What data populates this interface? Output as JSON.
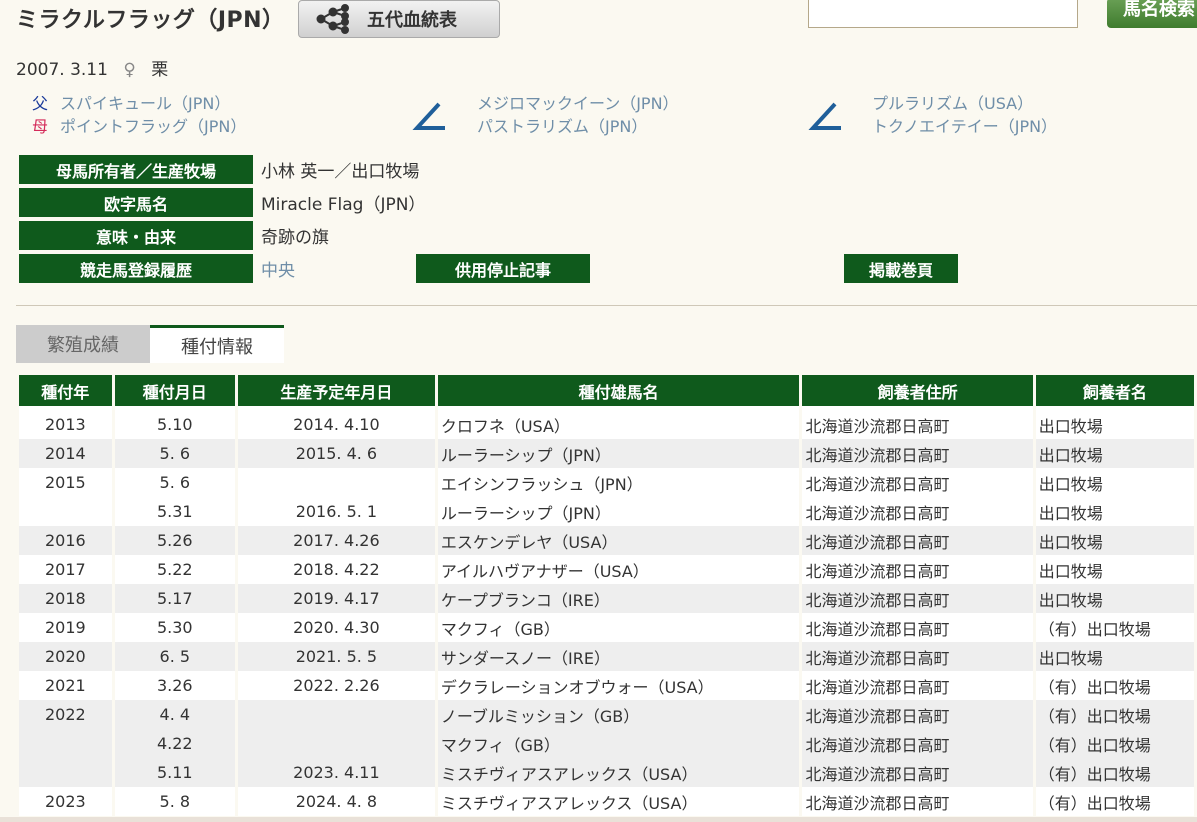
{
  "horse": {
    "name": "ミラクルフラッグ（JPN）",
    "pedigree_button": "五代血統表",
    "birth_date": "2007. 3.11",
    "sex_symbol": "♀",
    "color": "栗"
  },
  "search": {
    "button_label": "馬名検索"
  },
  "parents": {
    "sire_tag": "父",
    "dam_tag": "母",
    "sire": "スパイキュール（JPN）",
    "dam": "ポイントフラッグ（JPN）",
    "sire_sire": "メジロマックイーン（JPN）",
    "sire_dam": "パストラリズム（JPN）",
    "dam_sire": "プルラリズム（USA）",
    "dam_dam": "トクノエイテイー（JPN）"
  },
  "info": {
    "owner_label": "母馬所有者／生産牧場",
    "owner_value": "小林 英一／出口牧場",
    "roman_label": "欧字馬名",
    "roman_value": "Miracle Flag（JPN）",
    "meaning_label": "意味・由来",
    "meaning_value": "奇跡の旗",
    "race_label": "競走馬登録履歴",
    "race_value": "中央",
    "retire_button": "供用停止記事",
    "page_button": "掲載巻頁"
  },
  "tabs": {
    "breeding_results": "繁殖成績",
    "mating_info": "種付情報"
  },
  "table": {
    "headers": [
      "種付年",
      "種付月日",
      "生産予定年月日",
      "種付雄馬名",
      "飼養者住所",
      "飼養者名"
    ],
    "rows": [
      {
        "year": "2013",
        "date": "5.10",
        "due": "2014. 4.10",
        "sire": "クロフネ（USA）",
        "address": "北海道沙流郡日高町",
        "keeper": "出口牧場"
      },
      {
        "year": "2014",
        "date": "5. 6",
        "due": "2015. 4. 6",
        "sire": "ルーラーシップ（JPN）",
        "address": "北海道沙流郡日高町",
        "keeper": "出口牧場"
      },
      {
        "year": "2015",
        "date": "5. 6",
        "due": "",
        "sire": "エイシンフラッシュ（JPN）",
        "address": "北海道沙流郡日高町",
        "keeper": "出口牧場"
      },
      {
        "year": "",
        "date": "5.31",
        "due": "2016. 5. 1",
        "sire": "ルーラーシップ（JPN）",
        "address": "北海道沙流郡日高町",
        "keeper": "出口牧場"
      },
      {
        "year": "2016",
        "date": "5.26",
        "due": "2017. 4.26",
        "sire": "エスケンデレヤ（USA）",
        "address": "北海道沙流郡日高町",
        "keeper": "出口牧場"
      },
      {
        "year": "2017",
        "date": "5.22",
        "due": "2018. 4.22",
        "sire": "アイルハヴアナザー（USA）",
        "address": "北海道沙流郡日高町",
        "keeper": "出口牧場"
      },
      {
        "year": "2018",
        "date": "5.17",
        "due": "2019. 4.17",
        "sire": "ケープブランコ（IRE）",
        "address": "北海道沙流郡日高町",
        "keeper": "出口牧場"
      },
      {
        "year": "2019",
        "date": "5.30",
        "due": "2020. 4.30",
        "sire": "マクフィ（GB）",
        "address": "北海道沙流郡日高町",
        "keeper": "（有）出口牧場"
      },
      {
        "year": "2020",
        "date": "6. 5",
        "due": "2021. 5. 5",
        "sire": "サンダースノー（IRE）",
        "address": "北海道沙流郡日高町",
        "keeper": "出口牧場"
      },
      {
        "year": "2021",
        "date": "3.26",
        "due": "2022. 2.26",
        "sire": "デクラレーションオブウォー（USA）",
        "address": "北海道沙流郡日高町",
        "keeper": "（有）出口牧場"
      },
      {
        "year": "2022",
        "date": "4. 4",
        "due": "",
        "sire": "ノーブルミッション（GB）",
        "address": "北海道沙流郡日高町",
        "keeper": "（有）出口牧場"
      },
      {
        "year": "",
        "date": "4.22",
        "due": "",
        "sire": "マクフィ（GB）",
        "address": "北海道沙流郡日高町",
        "keeper": "（有）出口牧場"
      },
      {
        "year": "",
        "date": "5.11",
        "due": "2023. 4.11",
        "sire": "ミスチヴィアスアレックス（USA）",
        "address": "北海道沙流郡日高町",
        "keeper": "（有）出口牧場"
      },
      {
        "year": "2023",
        "date": "5. 8",
        "due": "2024. 4. 8",
        "sire": "ミスチヴィアスアレックス（USA）",
        "address": "北海道沙流郡日高町",
        "keeper": "（有）出口牧場"
      }
    ]
  },
  "colors": {
    "header_green": "#0f5a1c",
    "link_blue": "#6f8ea8",
    "bracket_blue": "#1f5f9a"
  }
}
